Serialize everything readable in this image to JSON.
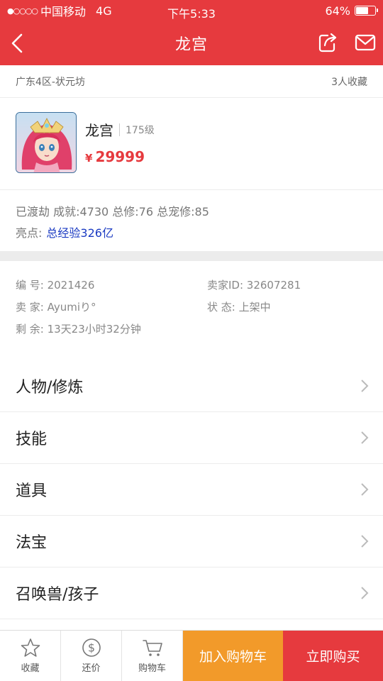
{
  "status_bar": {
    "signal": "●○○○○",
    "carrier": "中国移动",
    "network": "4G",
    "time": "下午5:33",
    "battery": "64%",
    "battery_level": 0.64
  },
  "nav": {
    "title": "龙宫"
  },
  "region": {
    "server": "广东4区-状元坊",
    "favorites": "3人收藏"
  },
  "product": {
    "name": "龙宫",
    "level": "175级",
    "currency": "¥",
    "price": "29999"
  },
  "meta": {
    "stats": "已渡劫 成就:4730 总修:76 总宠修:85",
    "highlight_label": "亮点:",
    "highlight_value": "总经验326亿"
  },
  "details": {
    "id": "编  号: 2021426",
    "seller_id": "卖家ID: 32607281",
    "seller": "卖  家: Ayumiり°",
    "status": "状  态: 上架中",
    "remaining": "剩  余: 13天23小时32分钟"
  },
  "menu": [
    {
      "label": "人物/修炼"
    },
    {
      "label": "技能"
    },
    {
      "label": "道具"
    },
    {
      "label": "法宝"
    },
    {
      "label": "召唤兽/孩子"
    }
  ],
  "bottom_bar": {
    "favorite": "收藏",
    "counter_offer": "还价",
    "cart": "购物车",
    "add_to_cart": "加入购物车",
    "buy_now": "立即购买"
  },
  "colors": {
    "brand_red": "#e63a3e",
    "orange": "#f29a2a",
    "highlight_blue": "#1a3ac2"
  },
  "icons": [
    "back-icon",
    "share-icon",
    "mail-icon",
    "star-icon",
    "dollar-icon",
    "cart-icon",
    "chevron-right-icon"
  ]
}
